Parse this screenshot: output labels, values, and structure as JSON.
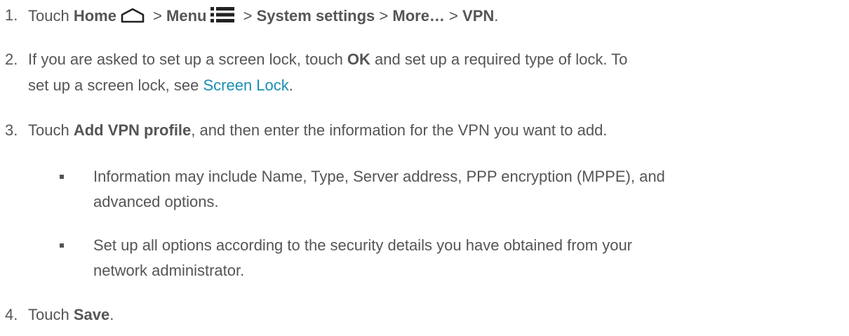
{
  "steps": [
    {
      "number": "1.",
      "touch": "Touch ",
      "home": "Home",
      "sep1": " > ",
      "menu": "Menu",
      "sep2": " > ",
      "system_settings": "System settings",
      "sep3": " > ",
      "more": "More…",
      "sep4": " > ",
      "vpn": "VPN",
      "end": "."
    },
    {
      "number": "2.",
      "line1_a": "If you are asked to set up a screen lock, touch ",
      "ok": "OK",
      "line1_b": " and set up a required type of lock. To",
      "line2_a": "set up a screen lock, see ",
      "link": "Screen Lock",
      "line2_b": "."
    },
    {
      "number": "3.",
      "touch": "Touch ",
      "add_vpn": "Add VPN profile",
      "rest": ", and then enter the information for the VPN you want to add."
    },
    {
      "number": "4.",
      "touch": "Touch ",
      "save": "Save",
      "end": "."
    }
  ],
  "bullets": [
    {
      "line1": "Information may include Name, Type, Server address, PPP encryption (MPPE), and",
      "line2": "advanced options."
    },
    {
      "line1": "Set up all options according to the security details you have obtained from your",
      "line2": "network administrator."
    }
  ],
  "icons": {
    "home": "home-icon",
    "menu": "menu-icon"
  },
  "colors": {
    "text": "#555555",
    "link": "#1a8fb5"
  }
}
